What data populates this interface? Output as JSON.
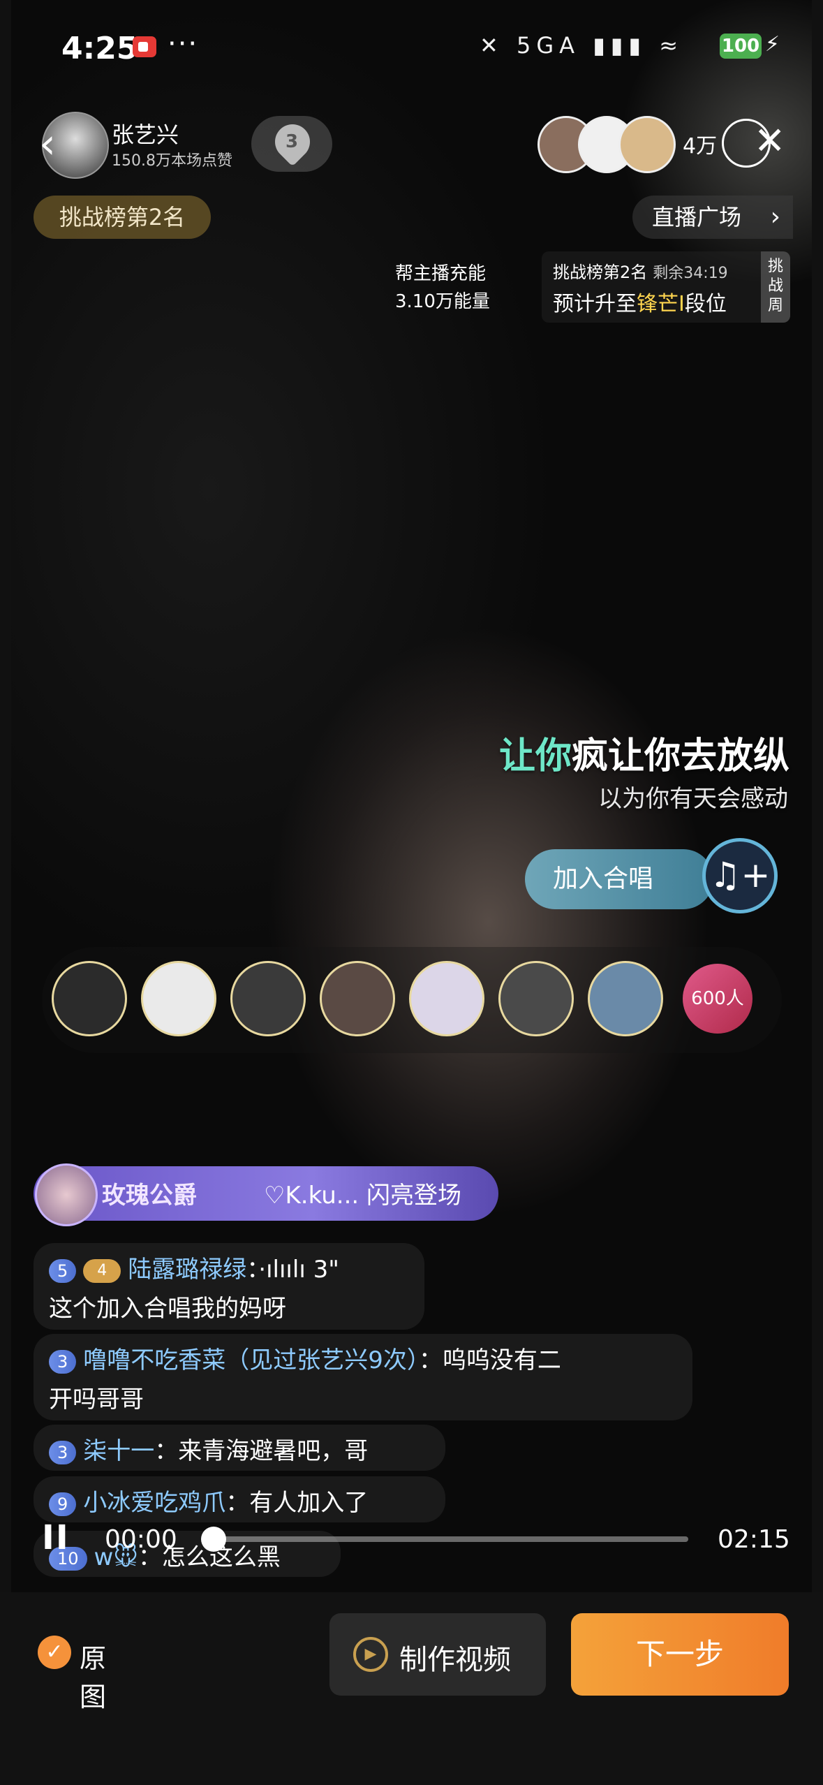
{
  "status_bar": {
    "time": "4:25",
    "more": "···",
    "signal": "✕ 5GA ▮▮▮ ≈",
    "battery": "100",
    "charging": "⚡"
  },
  "host": {
    "name": "张艺兴",
    "likes": "150.8万本场点赞",
    "fan_level": "3"
  },
  "viewers": {
    "count": "4万"
  },
  "top": {
    "rank_label": "挑战榜第2名",
    "plaza_label": "直播广场",
    "plaza_chevron": "›"
  },
  "energy": {
    "line1": "帮主播充能",
    "line2": "3.10万能量"
  },
  "challenge": {
    "title": "挑战榜第2名",
    "remaining": "剩余34:19",
    "forecast_prefix": "预计升至",
    "forecast_highlight": "锋芒I",
    "forecast_suffix": "段位",
    "tag": "挑战周"
  },
  "lyrics": {
    "line1_sung": "让你",
    "line1_rest": "疯让你去放纵",
    "line2": "以为你有天会感动"
  },
  "chorus": {
    "label": "加入合唱",
    "icon": "♫+"
  },
  "singers": {
    "count": "600人"
  },
  "entrance": {
    "rank": "玫瑰公爵",
    "message": "♡K.ku... 闪亮登场"
  },
  "chat": [
    {
      "level": "5",
      "fan": "4",
      "user": "陆露璐禄绿",
      "voice": "·ılıılı 3\"",
      "text": "这个加入合唱我的妈呀"
    },
    {
      "level": "3",
      "user": "噜噜不吃香菜（见过张艺兴9次）",
      "text": "呜呜没有二",
      "text2": "开吗哥哥"
    },
    {
      "level": "3",
      "user": "柒十一",
      "text": "来青海避暑吧，哥"
    },
    {
      "level": "9",
      "user": "小冰爱吃鸡爪",
      "text": "有人加入了"
    },
    {
      "level": "10",
      "user": "w🐭",
      "text": "怎么这么黑"
    }
  ],
  "player": {
    "pause": "II",
    "current": "00:00",
    "total": "02:15",
    "progress": 0
  },
  "bottom": {
    "original_label": "原图",
    "make_video": "制作视频",
    "next": "下一步"
  },
  "colors": {
    "accent_orange": "#f5923b",
    "lyric_highlight": "#6ee7c8",
    "username_blue": "#8ecbff"
  }
}
